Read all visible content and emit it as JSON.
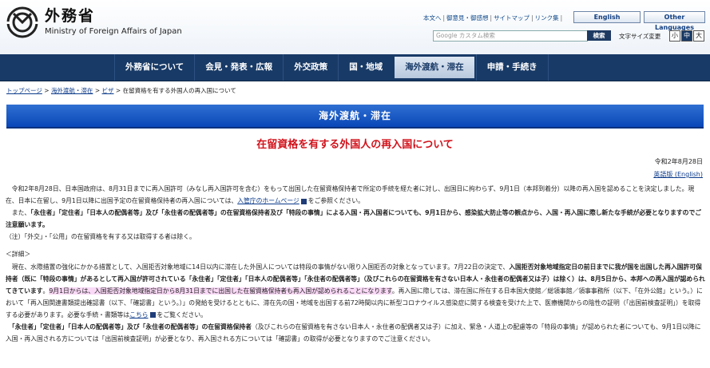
{
  "colors": {
    "nav_bg": "#183a66",
    "banner_bg": "#0a47b8",
    "title_red": "#d1121b",
    "link": "#0b3a8a",
    "highlight": "#f9d9f6"
  },
  "header": {
    "logo_ja": "外務省",
    "logo_en": "Ministry of Foreign Affairs of Japan",
    "top_links": [
      "本文へ",
      "御意見・御感想",
      "サイトマップ",
      "リンク集"
    ],
    "english_label": "English",
    "other_languages_label": "Other Languages",
    "search_placeholder": "Google カスタム検索",
    "search_button": "検索",
    "font_size_label": "文字サイズ変更",
    "font_sizes": [
      "小",
      "中",
      "大"
    ]
  },
  "nav": {
    "items": [
      "外務省について",
      "会見・発表・広報",
      "外交政策",
      "国・地域",
      "海外渡航・滞在",
      "申請・手続き"
    ],
    "active_index": 4
  },
  "breadcrumb": {
    "items": [
      "トップページ",
      "海外渡航・滞在",
      "ビザ"
    ],
    "current": "在留資格を有する外国人の再入国について",
    "separator": ">"
  },
  "banner": "海外渡航・滞在",
  "page_title": "在留資格を有する外国人の再入国について",
  "date": "令和2年8月28日",
  "english_version_link": "英語版 (English)",
  "paragraphs": {
    "p1_a": "　令和2年8月28日、日本国政府は、8月31日までに再入国許可（みなし再入国許可を含む）をもって出国した在留資格保持者で所定の手続を経た者に対し、出国日に拘わらず、9月1日（本邦到着分）以降の再入国を認めることを決定しました。現在、日本に在留し、9月1日以降に出国予定の在留資格保持者の再入国については、",
    "p1_link": "入管庁のホームページ",
    "p1_b": "をご参照ください。",
    "p2_a": "　また、",
    "p2_bold": "「永住者」「定住者」「日本人の配偶者等」及び「永住者の配偶者等」の在留資格保持者及び「特段の事情」による入国・再入国者についても、9月1日から、感染拡大防止等の観点から、入国・再入国に際し新たな手続が必要となりますのでご注意願います。",
    "note": "（注）「外交」・「公用」の在留資格を有する又は取得する者は除く。",
    "detail_heading": "＜詳細＞",
    "p3_a": "　現在、水際措置の強化にかかる措置として、入国拒否対象地域に14日以内に滞在した外国人については特段の事情がない限り入国拒否の対象となっています。7月22日の決定で、",
    "p3_bold": "入国拒否対象地域指定日の前日までに我が国を出国した再入国許可保持者（既に「特段の事情」があるとして再入国が許可されている「永住者」「定住者」「日本人の配偶者等」「永住者の配偶者等」（及びこれらの在留資格を有さない日本人・永住者の配偶者又は子）は除く）は、8月5日から、本邦への再入国が認められてきています",
    "p3_b": "。",
    "p3_highlight": "9月1日からは、入国拒否対象地域指定日から8月31日までに出国した在留資格保持者も再入国が認められることになります",
    "p3_c": "。再入国に際しては、滞在国に所在する日本国大使館／総領事館／領事事務所（以下、「在外公館」という。）において「再入国関連書類提出確認書（以下、「確認書」という。）」の発給を受けるとともに、滞在先の国・地域を出国する前72時間以内に新型コロナウイルス感染症に関する検査を受けた上で、医療機関からの陰性の証明（「出国前検査証明」）を取得する必要があります。必要な手続・書類等は",
    "p3_link": "こちら",
    "p3_d": "をご覧ください。",
    "p4_bold_a": "　「永住者」「定住者」「日本人の配偶者等」及び「永住者の配偶者等」の在留資格保持者",
    "p4_a": "（及びこれらの在留資格を有さない日本人・永住者の配偶者又は子）に加え、緊急・人道上の配慮等の「特段の事情」が認められた者についても、9月1日以降に入国・再入国される方については「出国前検査証明」が必要となり、再入国される方については「確認書」の取得が必要となりますのでご注意ください。"
  }
}
